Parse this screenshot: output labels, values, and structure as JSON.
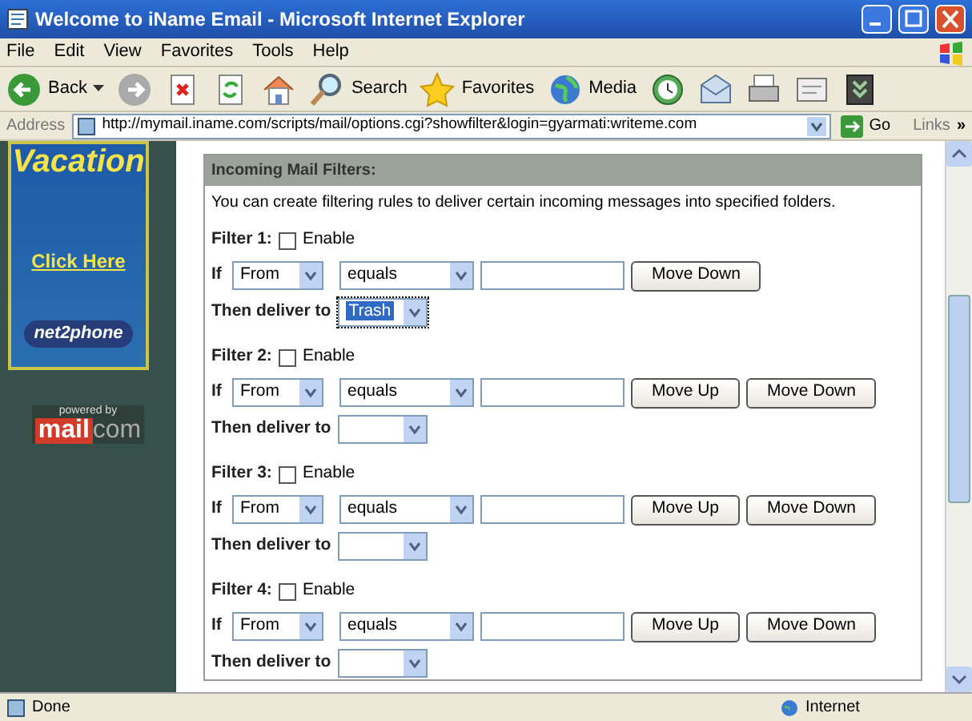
{
  "window": {
    "title": "Welcome to iName Email - Microsoft Internet Explorer"
  },
  "menu": [
    "File",
    "Edit",
    "View",
    "Favorites",
    "Tools",
    "Help"
  ],
  "toolbar": [
    {
      "kind": "back",
      "label": "Back"
    },
    {
      "kind": "forward"
    },
    {
      "kind": "stop"
    },
    {
      "kind": "refresh"
    },
    {
      "kind": "home"
    },
    {
      "kind": "search",
      "label": "Search"
    },
    {
      "kind": "favorites",
      "label": "Favorites"
    },
    {
      "kind": "media",
      "label": "Media"
    },
    {
      "kind": "history"
    },
    {
      "kind": "mail"
    },
    {
      "kind": "print"
    },
    {
      "kind": "edit"
    },
    {
      "kind": "messenger"
    }
  ],
  "address": {
    "label": "Address",
    "url": "http://mymail.iname.com/scripts/mail/options.cgi?showfilter&login=gyarmati:writeme.com",
    "go": "Go",
    "links": "Links",
    "more": "»"
  },
  "sidebar": {
    "ad": {
      "headline": "Vacation",
      "link": "Click Here",
      "brand": "net2phone"
    },
    "powered": {
      "caption": "powered by",
      "logo_main": "mail",
      "logo_suffix": "com"
    }
  },
  "filters_panel": {
    "title": "Incoming Mail Filters:",
    "description": "You can create filtering rules to deliver certain incoming messages into specified folders.",
    "filters": [
      {
        "label": "Filter 1:",
        "enable_label": "Enable",
        "enabled": false,
        "if_label": "If",
        "field": "From",
        "operator": "equals",
        "buttons": [
          "Move Down"
        ],
        "deliver_label": "Then deliver to",
        "folder": "Trash",
        "focused": true
      },
      {
        "label": "Filter 2:",
        "enable_label": "Enable",
        "enabled": false,
        "if_label": "If",
        "field": "From",
        "operator": "equals",
        "buttons": [
          "Move Up",
          "Move Down"
        ],
        "deliver_label": "Then deliver to",
        "focused": false
      },
      {
        "label": "Filter 3:",
        "enable_label": "Enable",
        "enabled": false,
        "if_label": "If",
        "field": "From",
        "operator": "equals",
        "buttons": [
          "Move Up",
          "Move Down"
        ],
        "deliver_label": "Then deliver to",
        "focused": false
      },
      {
        "label": "Filter 4:",
        "enable_label": "Enable",
        "enabled": false,
        "if_label": "If",
        "field": "From",
        "operator": "equals",
        "buttons": [
          "Move Up",
          "Move Down"
        ],
        "deliver_label": "Then deliver to",
        "focused": false
      }
    ]
  },
  "status_bar": {
    "text": "Done",
    "zone": "Internet"
  }
}
